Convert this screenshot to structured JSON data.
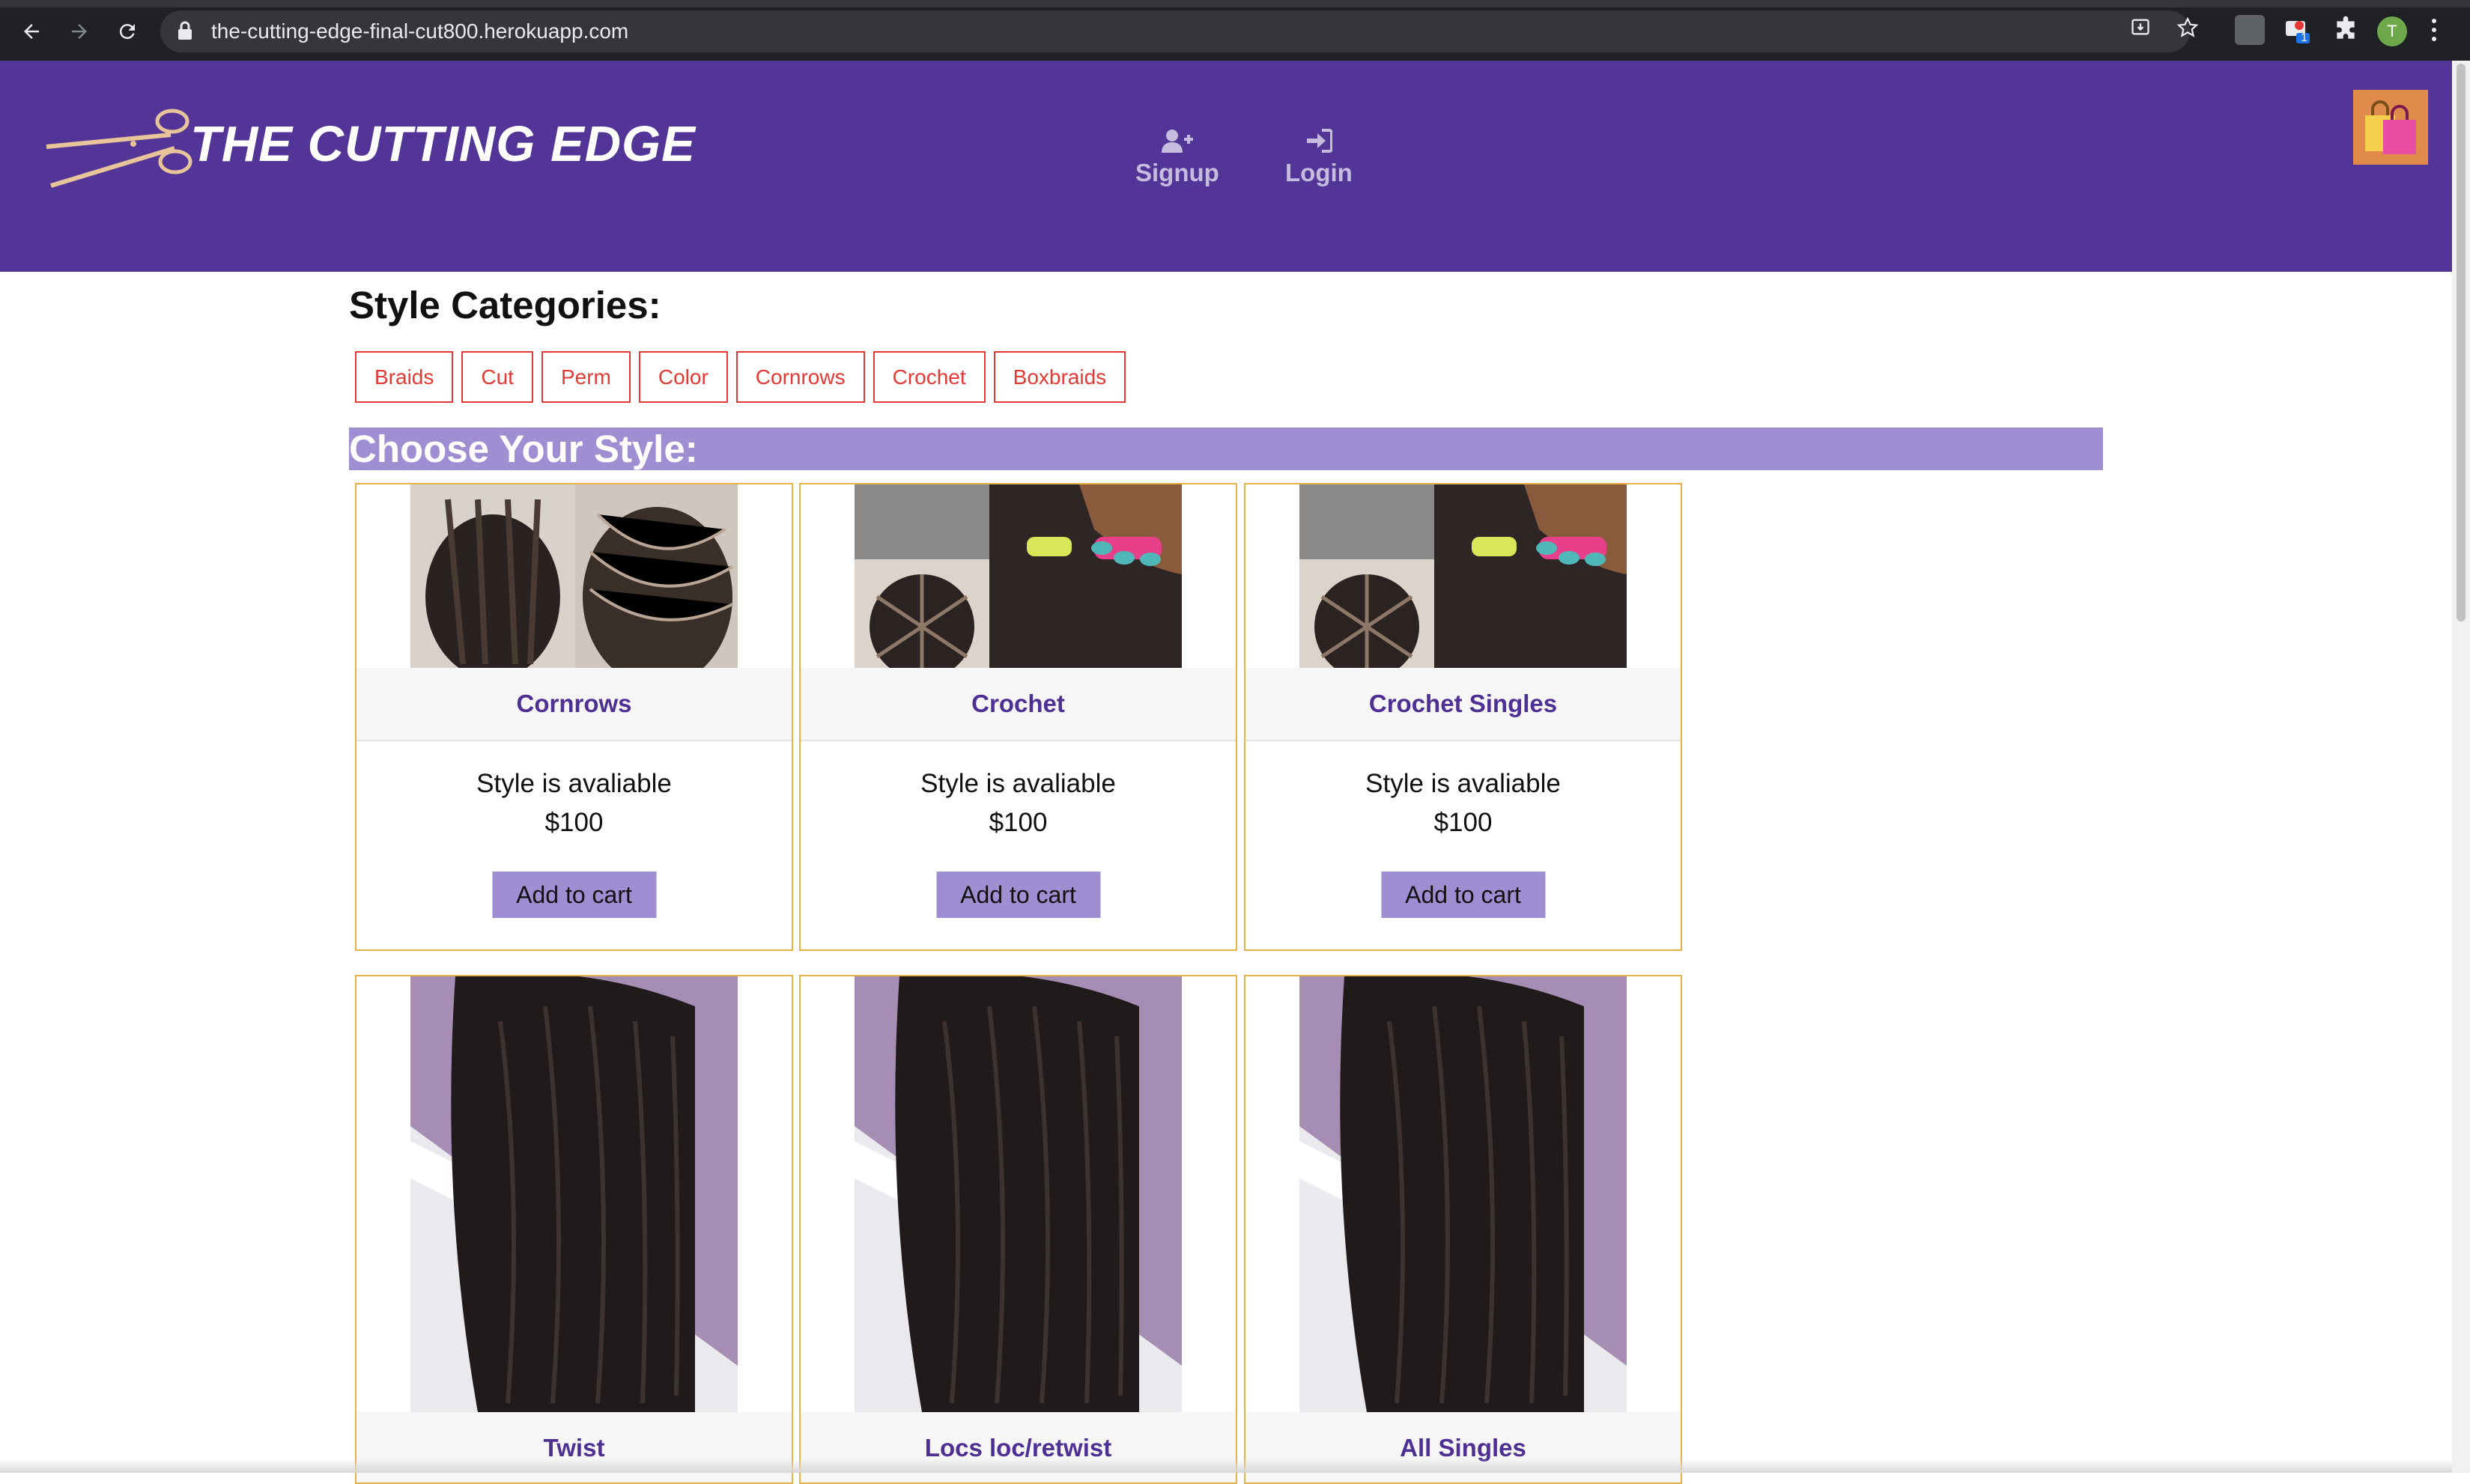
{
  "browser": {
    "url": "the-cutting-edge-final-cut800.herokuapp.com",
    "profile_initial": "T",
    "extension_badge": "1"
  },
  "header": {
    "brand": "THE CUTTING EDGE",
    "nav": [
      {
        "label": "Signup",
        "icon": "user-plus-icon"
      },
      {
        "label": "Login",
        "icon": "sign-in-icon"
      }
    ],
    "cart_icon": "shopping-bags-icon",
    "colors": {
      "header_bg": "#533597",
      "accent": "#a08ed2",
      "category_red": "#e53935",
      "card_border": "#e8b24a"
    }
  },
  "categories": {
    "title": "Style Categories:",
    "items": [
      "Braids",
      "Cut",
      "Perm",
      "Color",
      "Cornrows",
      "Crochet",
      "Boxbraids"
    ]
  },
  "styles": {
    "title": "Choose Your Style:",
    "cards": [
      {
        "name": "Cornrows",
        "status": "Style is avaliable",
        "price": "$100",
        "button": "Add to cart"
      },
      {
        "name": "Crochet",
        "status": "Style is avaliable",
        "price": "$100",
        "button": "Add to cart"
      },
      {
        "name": "Crochet Singles",
        "status": "Style is avaliable",
        "price": "$100",
        "button": "Add to cart"
      },
      {
        "name": "Twist"
      },
      {
        "name": "Locs loc/retwist"
      },
      {
        "name": "All Singles"
      }
    ]
  }
}
